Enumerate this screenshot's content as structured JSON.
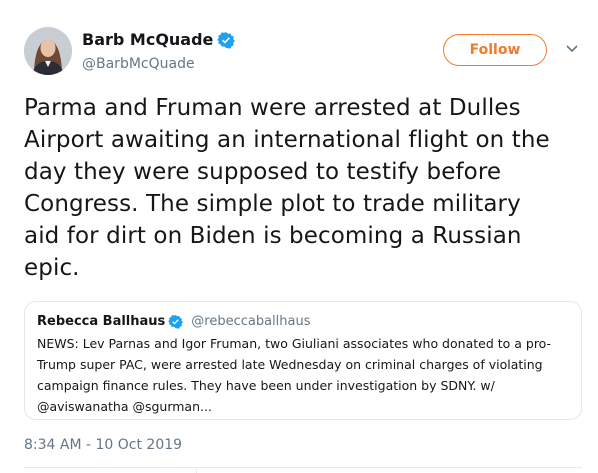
{
  "author": {
    "name": "Barb McQuade",
    "handle": "@BarbMcQuade",
    "verified": true
  },
  "follow_button": {
    "label": "Follow",
    "color": "#f47a2a"
  },
  "tweet": {
    "lines": [
      "Parma and Fruman were arrested at Dulles",
      "Airport awaiting an international flight on the",
      "day they were supposed to testify before",
      "Congress. The simple plot to trade military",
      "aid for dirt on Biden is becoming a Russian",
      "epic."
    ]
  },
  "quoted_tweet": {
    "name": "Rebecca Ballhaus",
    "handle": "@rebeccaballhaus",
    "verified": true,
    "lines": [
      "NEWS: Lev Parnas and Igor Fruman, two Giuliani associates who donated to a pro-",
      "Trump super PAC, were arrested late Wednesday on criminal charges of violating",
      "campaign finance rules. They have been under investigation by SDNY. w/",
      "@aviswanatha @sgurman..."
    ]
  },
  "timestamp": "8:34 AM - 10 Oct 2019",
  "colors": {
    "verified_blue": "#1da1f2",
    "text": "#14171a",
    "muted": "#657786"
  }
}
